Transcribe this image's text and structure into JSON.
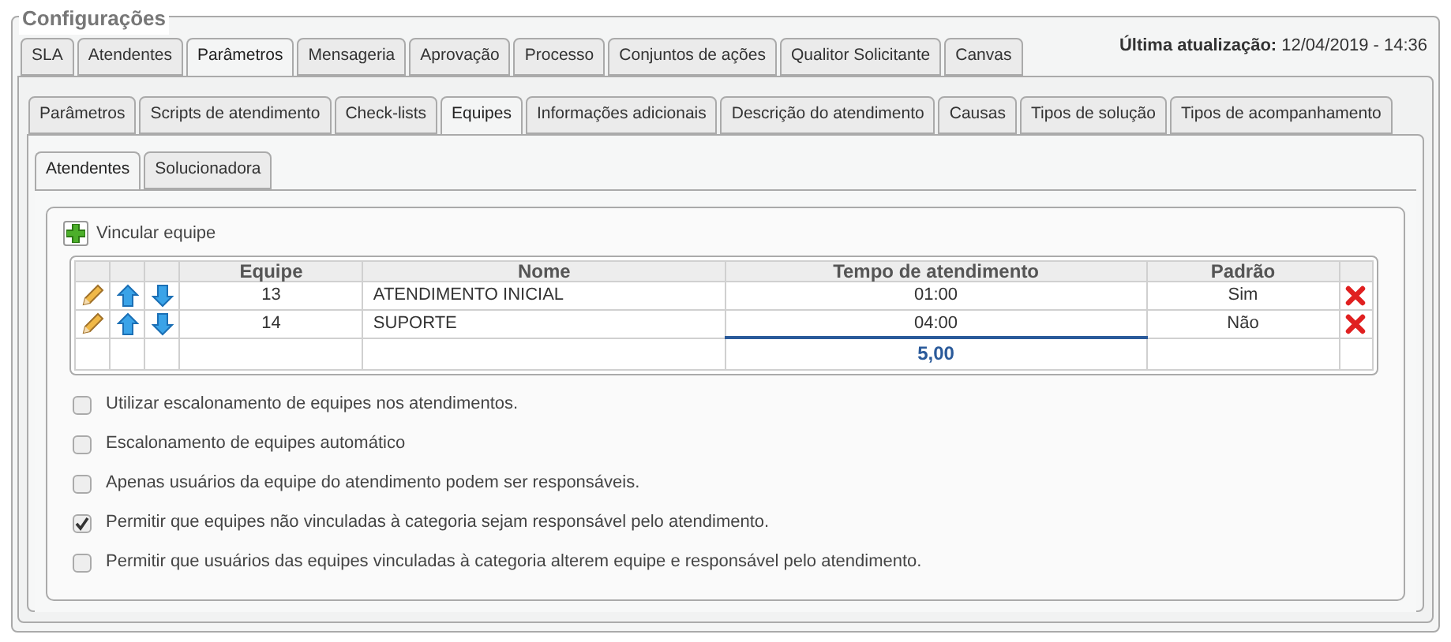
{
  "legend": "Configurações",
  "last_update": {
    "label": "Última atualização:",
    "value": "12/04/2019 - 14:36"
  },
  "tabs": [
    {
      "label": "SLA",
      "selected": false
    },
    {
      "label": "Atendentes",
      "selected": false
    },
    {
      "label": "Parâmetros",
      "selected": true
    },
    {
      "label": "Mensageria",
      "selected": false
    },
    {
      "label": "Aprovação",
      "selected": false
    },
    {
      "label": "Processo",
      "selected": false
    },
    {
      "label": "Conjuntos de ações",
      "selected": false
    },
    {
      "label": "Qualitor Solicitante",
      "selected": false
    },
    {
      "label": "Canvas",
      "selected": false
    }
  ],
  "subtabs": [
    {
      "label": "Parâmetros",
      "selected": false
    },
    {
      "label": "Scripts de atendimento",
      "selected": false
    },
    {
      "label": "Check-lists",
      "selected": false
    },
    {
      "label": "Equipes",
      "selected": true
    },
    {
      "label": "Informações adicionais",
      "selected": false
    },
    {
      "label": "Descrição do atendimento",
      "selected": false
    },
    {
      "label": "Causas",
      "selected": false
    },
    {
      "label": "Tipos de solução",
      "selected": false
    },
    {
      "label": "Tipos de acompanhamento",
      "selected": false
    }
  ],
  "team_tabs": [
    {
      "label": "Atendentes",
      "selected": true
    },
    {
      "label": "Solucionadora",
      "selected": false
    }
  ],
  "add_button": "Vincular equipe",
  "table": {
    "columns": [
      "Equipe",
      "Nome",
      "Tempo de atendimento",
      "Padrão"
    ],
    "rows": [
      [
        "13",
        "ATENDIMENTO INICIAL",
        "01:00",
        "Sim"
      ],
      [
        "14",
        "SUPORTE",
        "04:00",
        "Não"
      ]
    ],
    "total": "5,00"
  },
  "options": [
    {
      "label": "Utilizar escalonamento de equipes nos atendimentos.",
      "checked": false
    },
    {
      "label": "Escalonamento de equipes automático",
      "checked": false
    },
    {
      "label": "Apenas usuários da equipe do atendimento podem ser responsáveis.",
      "checked": false
    },
    {
      "label": "Permitir que equipes não vinculadas à categoria sejam responsável pelo atendimento.",
      "checked": true
    },
    {
      "label": "Permitir que usuários das equipes vinculadas à categoria alterem equipe e responsável pelo atendimento.",
      "checked": false
    }
  ]
}
